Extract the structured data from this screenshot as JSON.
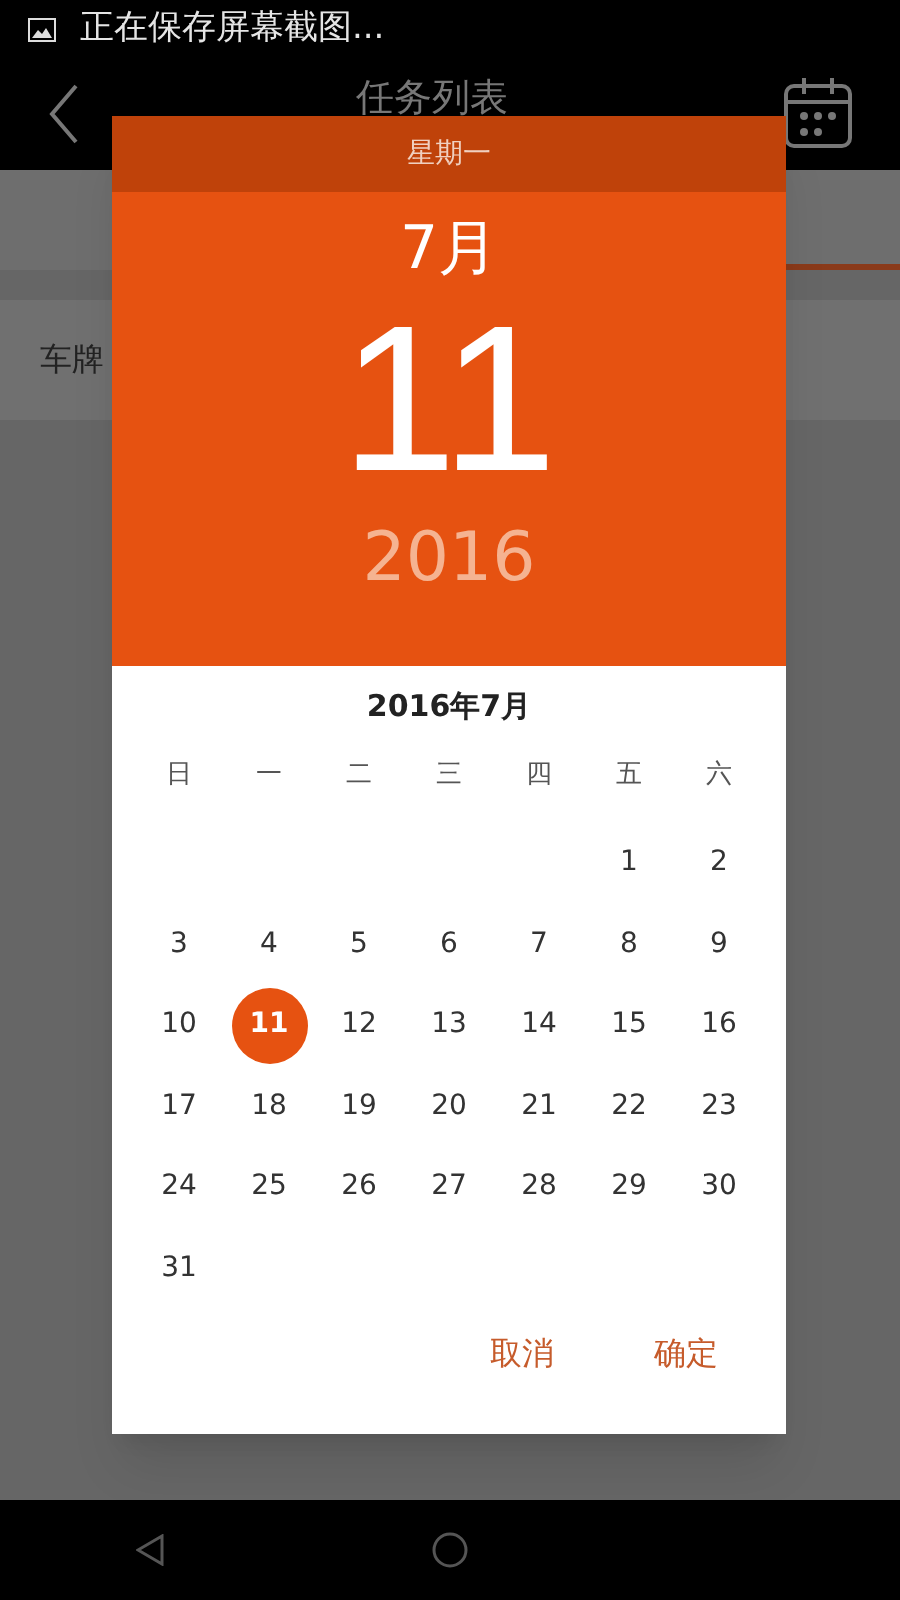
{
  "status_bar": {
    "notification": "正在保存屏幕截图..."
  },
  "app_bar": {
    "title": "任务列表"
  },
  "form": {
    "field_label": "车牌"
  },
  "date_picker": {
    "weekday": "星期一",
    "month": "7月",
    "day": "11",
    "year": "2016",
    "calendar": {
      "title": "2016年7月",
      "weekdays": [
        "日",
        "一",
        "二",
        "三",
        "四",
        "五",
        "六"
      ],
      "weeks": [
        [
          {
            "label": "1",
            "selected": false
          },
          {
            "label": "2",
            "selected": false
          }
        ],
        [
          {
            "label": "3",
            "selected": false
          },
          {
            "label": "4",
            "selected": false
          },
          {
            "label": "5",
            "selected": false
          },
          {
            "label": "6",
            "selected": false
          },
          {
            "label": "7",
            "selected": false
          },
          {
            "label": "8",
            "selected": false
          },
          {
            "label": "9",
            "selected": false
          }
        ],
        [
          {
            "label": "10",
            "selected": false
          },
          {
            "label": "11",
            "selected": true
          },
          {
            "label": "12",
            "selected": false
          },
          {
            "label": "13",
            "selected": false
          },
          {
            "label": "14",
            "selected": false
          },
          {
            "label": "15",
            "selected": false
          },
          {
            "label": "16",
            "selected": false
          }
        ],
        [
          {
            "label": "17",
            "selected": false
          },
          {
            "label": "18",
            "selected": false
          },
          {
            "label": "19",
            "selected": false
          },
          {
            "label": "20",
            "selected": false
          },
          {
            "label": "21",
            "selected": false
          },
          {
            "label": "22",
            "selected": false
          },
          {
            "label": "23",
            "selected": false
          }
        ],
        [
          {
            "label": "24",
            "selected": false
          },
          {
            "label": "25",
            "selected": false
          },
          {
            "label": "26",
            "selected": false
          },
          {
            "label": "27",
            "selected": false
          },
          {
            "label": "28",
            "selected": false
          },
          {
            "label": "29",
            "selected": false
          },
          {
            "label": "30",
            "selected": false
          }
        ],
        [
          {
            "label": "31",
            "selected": false
          }
        ]
      ]
    },
    "buttons": [
      "取消",
      "确定"
    ]
  }
}
